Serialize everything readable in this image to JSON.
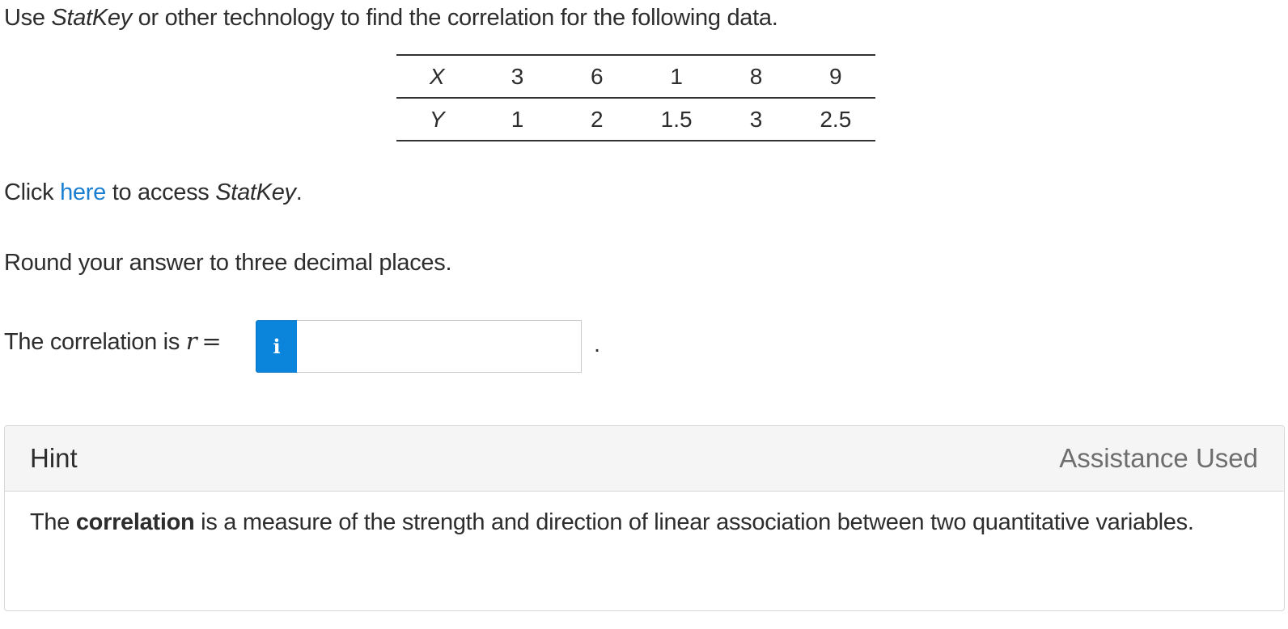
{
  "prompt": {
    "before": "Use ",
    "emphasis": "StatKey",
    "after": " or other technology to find the correlation for the following data."
  },
  "table": {
    "x_label": "X",
    "y_label": "Y",
    "x_values": [
      "3",
      "6",
      "1",
      "8",
      "9"
    ],
    "y_values": [
      "1",
      "2",
      "1.5",
      "3",
      "2.5"
    ]
  },
  "access": {
    "before": "Click ",
    "link_text": "here",
    "middle": " to access ",
    "emphasis": "StatKey",
    "after": "."
  },
  "instruction": "Round your answer to three decimal places.",
  "answer": {
    "label": "The correlation is ",
    "variable": "r",
    "equals": "=",
    "info_icon": "i",
    "value": "",
    "placeholder": "",
    "trailing": "."
  },
  "hint": {
    "title": "Hint",
    "status": "Assistance Used",
    "body_before": "The ",
    "body_bold": "correlation",
    "body_after": " is a measure of the strength and direction of linear association between two quantitative variables."
  }
}
